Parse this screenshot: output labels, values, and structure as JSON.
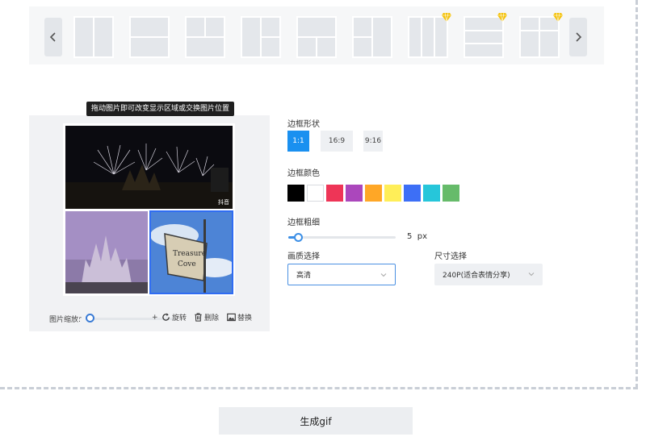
{
  "templates": {
    "prev_icon": "chevron-left-icon",
    "next_icon": "chevron-right-icon",
    "vip_icon": "diamond-icon",
    "vip_color": "#f4c20d"
  },
  "editor": {
    "tooltip": "拖动图片即可改变显示区域或交换图片位置",
    "zoom_label": "图片缩放:",
    "zoom_minus": "-",
    "zoom_plus": "+",
    "zoom_level": 0,
    "rotate_label": "旋转",
    "delete_label": "删除",
    "replace_label": "替换",
    "watermark": "抖音"
  },
  "settings": {
    "shape_label": "边框形状",
    "ratios": [
      {
        "label": "1:1",
        "active": true
      },
      {
        "label": "16:9",
        "active": false
      },
      {
        "label": "9:16",
        "active": false
      }
    ],
    "color_label": "边框颜色",
    "colors": [
      "#000000",
      "#ffffff",
      "#ee3557",
      "#ab47bc",
      "#ffa726",
      "#ffee58",
      "#3d6ff6",
      "#26c6da",
      "#66bb6a"
    ],
    "width_label": "边框粗细",
    "width_value": 5,
    "width_unit": "px",
    "width_display": "5  px",
    "quality_label": "画质选择",
    "quality_value": "高清",
    "size_label": "尺寸选择",
    "size_value": "240P(适合表情分享)"
  },
  "generate_label": "生成gif",
  "accent": "#1a90f0"
}
